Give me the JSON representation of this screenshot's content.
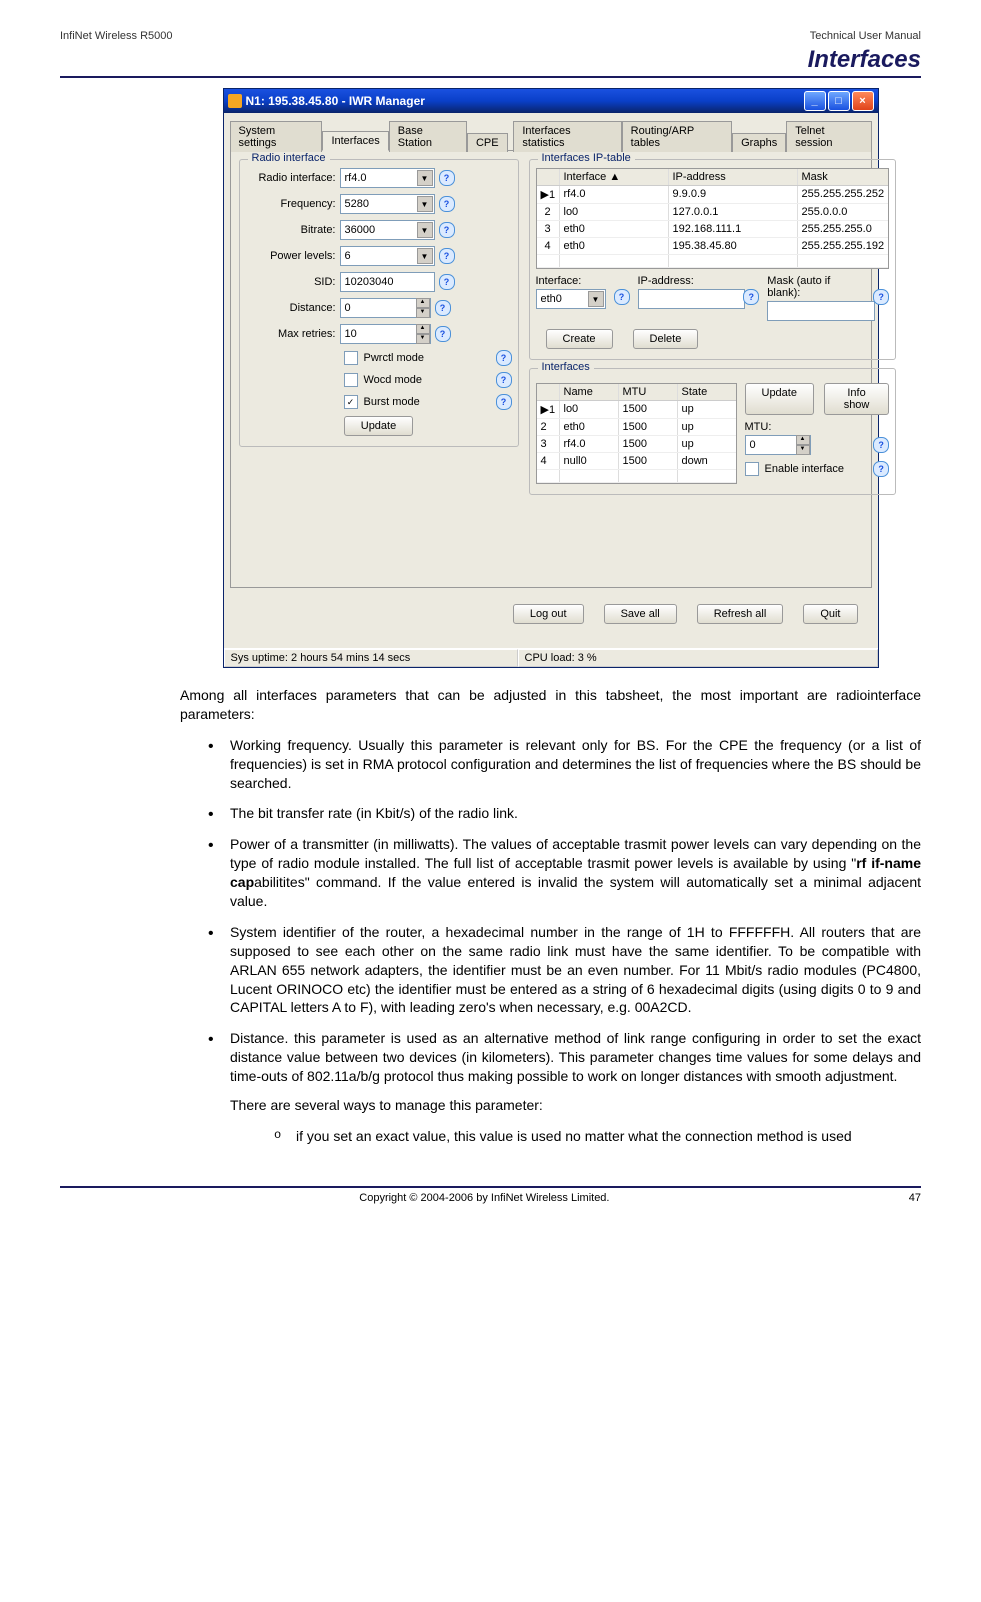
{
  "header": {
    "left": "InfiNet Wireless R5000",
    "right": "Technical User Manual"
  },
  "section_title": "Interfaces",
  "win": {
    "title": "N1: 195.38.45.80 - IWR Manager",
    "tabs": [
      "System settings",
      "Interfaces",
      "Base Station",
      "CPE",
      "Interfaces statistics",
      "Routing/ARP tables",
      "Graphs",
      "Telnet session"
    ],
    "radio": {
      "title": "Radio interface",
      "rows": {
        "radio_interface": {
          "label": "Radio interface:",
          "value": "rf4.0"
        },
        "frequency": {
          "label": "Frequency:",
          "value": "5280"
        },
        "bitrate": {
          "label": "Bitrate:",
          "value": "36000"
        },
        "power": {
          "label": "Power levels:",
          "value": "6"
        },
        "sid": {
          "label": "SID:",
          "value": "10203040"
        },
        "distance": {
          "label": "Distance:",
          "value": "0"
        },
        "retries": {
          "label": "Max retries:",
          "value": "10"
        }
      },
      "chk": {
        "pwrctl": "Pwrctl mode",
        "wocd": "Wocd mode",
        "burst": "Burst mode"
      },
      "update": "Update"
    },
    "ip": {
      "title": "Interfaces IP-table",
      "head": [
        "",
        "Interface",
        "IP-address",
        "Mask"
      ],
      "rows": [
        {
          "n": "1",
          "if": "rf4.0",
          "ip": "9.9.0.9",
          "mask": "255.255.255.252"
        },
        {
          "n": "2",
          "if": "lo0",
          "ip": "127.0.0.1",
          "mask": "255.0.0.0"
        },
        {
          "n": "3",
          "if": "eth0",
          "ip": "192.168.111.1",
          "mask": "255.255.255.0"
        },
        {
          "n": "4",
          "if": "eth0",
          "ip": "195.38.45.80",
          "mask": "255.255.255.192"
        }
      ],
      "lbl_if": "Interface:",
      "lbl_ip": "IP-address:",
      "lbl_mask": "Mask (auto if blank):",
      "val_if": "eth0",
      "create": "Create",
      "delete": "Delete"
    },
    "ifs": {
      "title": "Interfaces",
      "head": [
        "",
        "Name",
        "MTU",
        "State"
      ],
      "rows": [
        {
          "n": "1",
          "name": "lo0",
          "mtu": "1500",
          "state": "up"
        },
        {
          "n": "2",
          "name": "eth0",
          "mtu": "1500",
          "state": "up"
        },
        {
          "n": "3",
          "name": "rf4.0",
          "mtu": "1500",
          "state": "up"
        },
        {
          "n": "4",
          "name": "null0",
          "mtu": "1500",
          "state": "down"
        }
      ],
      "update": "Update",
      "info": "Info show",
      "mtu_label": "MTU:",
      "mtu_val": "0",
      "enable": "Enable interface"
    },
    "bottom": {
      "logout": "Log out",
      "saveall": "Save all",
      "refresh": "Refresh all",
      "quit": "Quit"
    },
    "status": {
      "uptime": "Sys uptime: 2 hours 54 mins 14 secs",
      "cpu": "CPU load: 3 %"
    }
  },
  "text": {
    "intro": "Among all interfaces parameters that can be adjusted in this tabsheet, the most important are radiointerface parameters:",
    "b1": "Working frequency. Usually this parameter is relevant only for BS. For the CPE the frequency (or a list of frequencies) is set in RMA protocol configuration and determines the list of frequencies where the BS should be searched.",
    "b2": "The bit transfer rate (in Kbit/s) of the radio link.",
    "b3a": "Power of a transmitter (in milliwatts). The values of acceptable trasmit power levels can vary depending on the type of radio module installed. The full list of acceptable trasmit power levels is available by using \"",
    "b3b": "rf if-name cap",
    "b3c": "abilitites\" command. If the value entered is invalid the system will automatically set a minimal adjacent value.",
    "b4": "System identifier of the router, a hexadecimal number in the range of 1H to FFFFFFH. All routers that are supposed to see each other on the same radio link must have the same identifier. To be compatible with ARLAN 655 network adapters, the identifier must be an even number. For 11 Mbit/s radio modules (PC4800, Lucent ORINOCO etc) the identifier must be entered as a string of 6 hexadecimal digits (using digits 0 to 9 and CAPITAL letters A to F), with leading zero's when necessary, e.g. 00A2CD.",
    "b5": "Distance. this parameter is used as an alternative method of link range configuring in order to set the exact distance value between two devices (in kilometers). This parameter changes time values for some delays and time-outs of 802.11a/b/g protocol thus making possible to work on longer distances with smooth adjustment.",
    "b5_sub": "There are several ways to manage this parameter:",
    "b5_o1": "if you set an exact value, this value is used no matter what the connection method is used"
  },
  "footer": {
    "copyright": "Copyright © 2004-2006 by InfiNet Wireless Limited.",
    "page": "47"
  }
}
